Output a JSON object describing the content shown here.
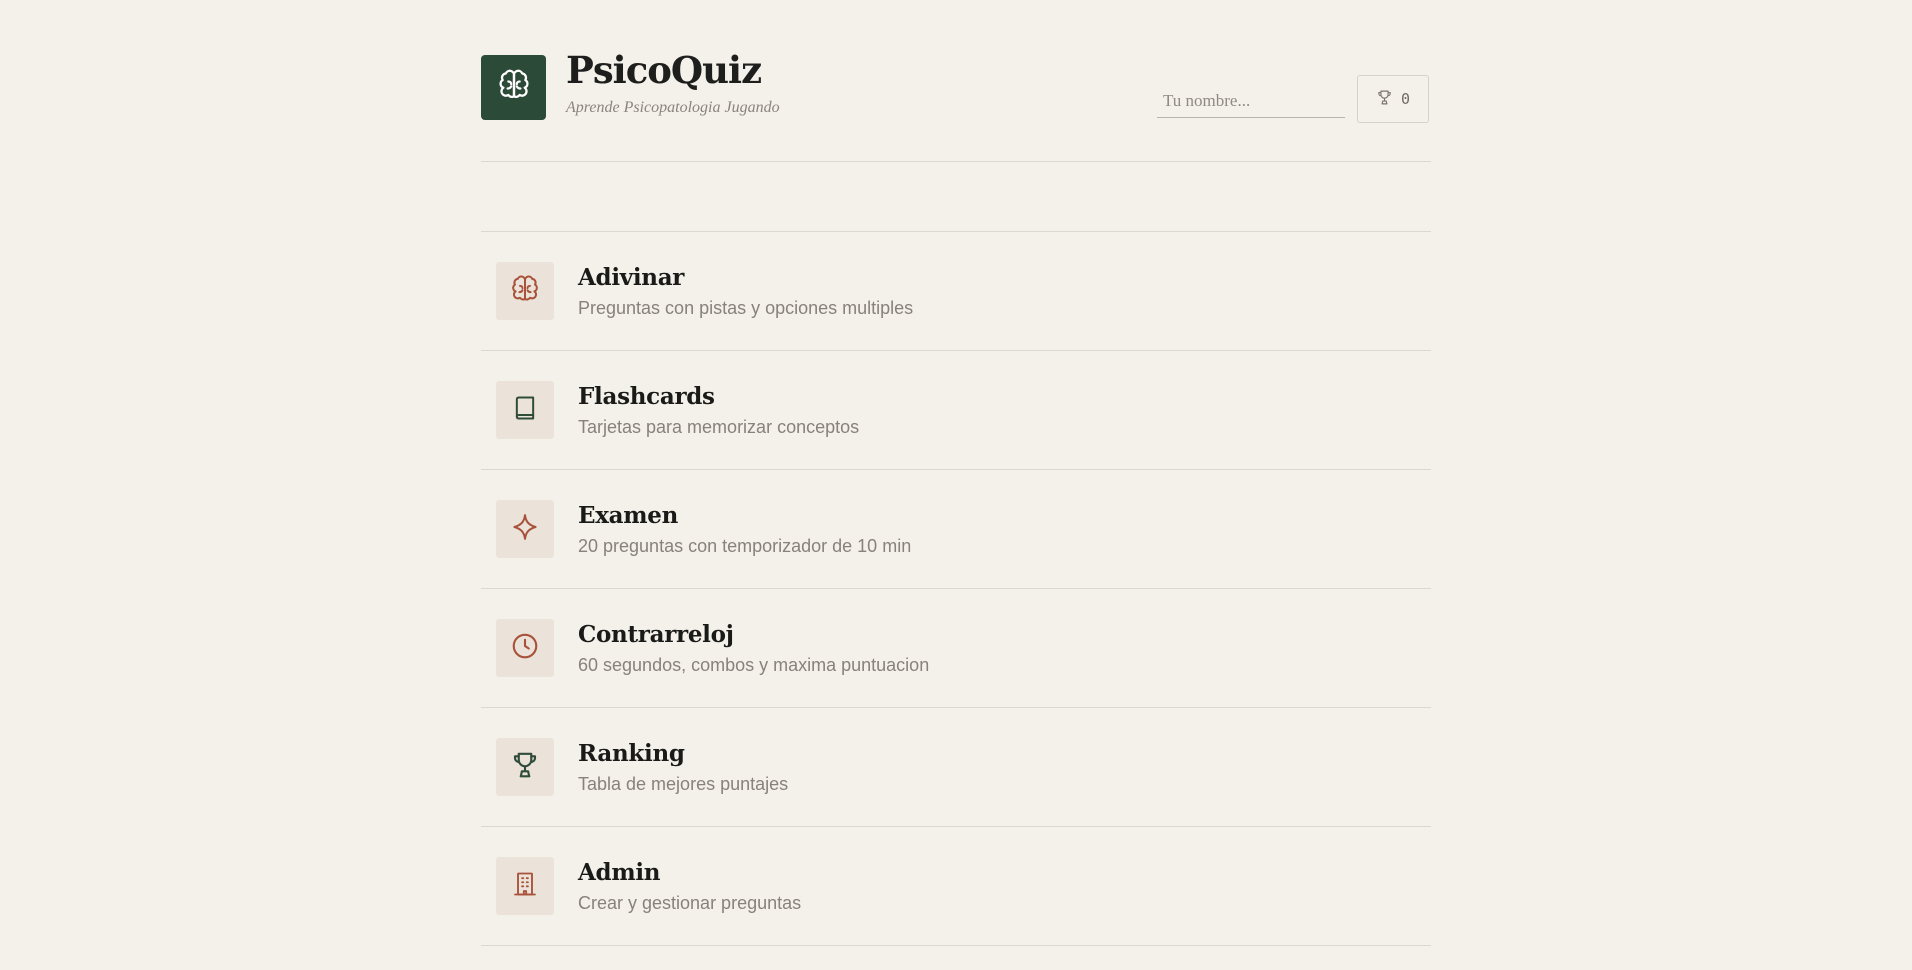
{
  "app": {
    "title": "PsicoQuiz",
    "subtitle": "Aprende Psicopatologia Jugando",
    "logo_icon": "brain-icon"
  },
  "header": {
    "name_placeholder": "Tu nombre...",
    "name_value": "",
    "score_icon": "trophy-icon",
    "score": "0"
  },
  "colors": {
    "background": "#f4f1ea",
    "logo_bg": "#2c4a38",
    "accent_terracotta": "#a8523a",
    "accent_green": "#2f4b3a",
    "tile_bg": "#ebe3da"
  },
  "menu": [
    {
      "title": "Adivinar",
      "description": "Preguntas con pistas y opciones multiples",
      "icon": "brain-icon"
    },
    {
      "title": "Flashcards",
      "description": "Tarjetas para memorizar conceptos",
      "icon": "book-icon"
    },
    {
      "title": "Examen",
      "description": "20 preguntas con temporizador de 10 min",
      "icon": "sparkle-icon"
    },
    {
      "title": "Contrarreloj",
      "description": "60 segundos, combos y maxima puntuacion",
      "icon": "clock-icon"
    },
    {
      "title": "Ranking",
      "description": "Tabla de mejores puntajes",
      "icon": "trophy-icon"
    },
    {
      "title": "Admin",
      "description": "Crear y gestionar preguntas",
      "icon": "building-icon"
    }
  ]
}
